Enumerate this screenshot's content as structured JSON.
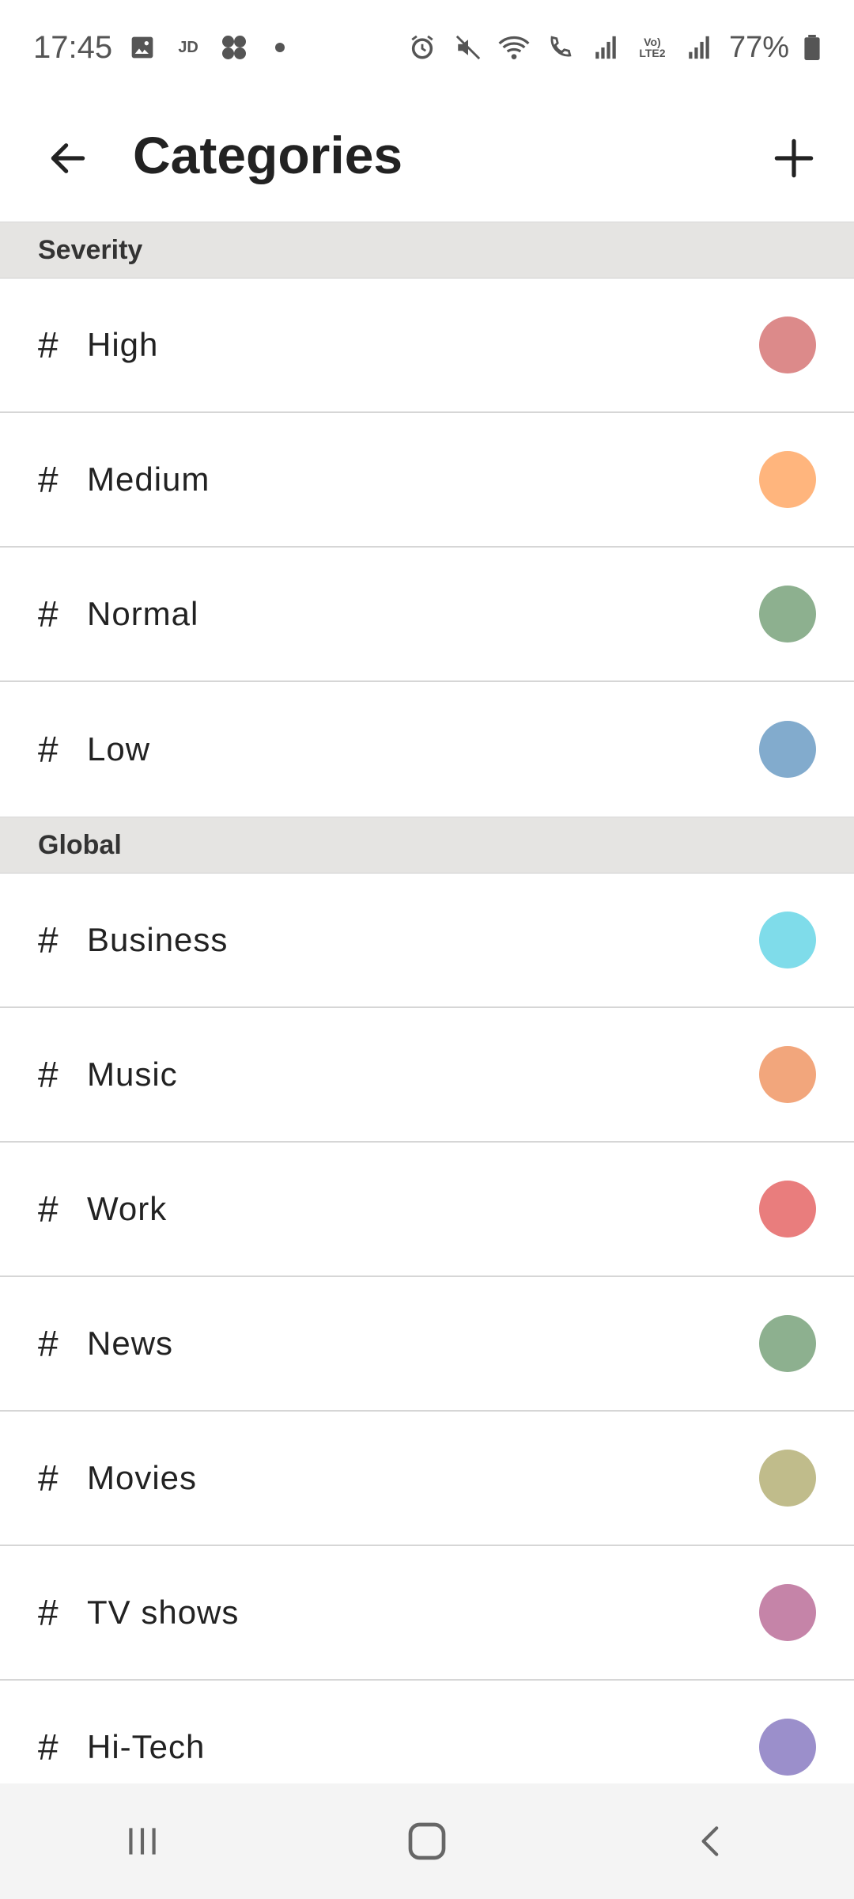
{
  "status_bar": {
    "time": "17:45",
    "left_icons": [
      "gallery-icon",
      "jd-icon",
      "fan-icon",
      "dot-icon"
    ],
    "right_icons": [
      "alarm-icon",
      "mute-icon",
      "wifi-icon",
      "call-icon",
      "signal-icon",
      "volte-icon",
      "signal-icon"
    ],
    "jd_label": "JD",
    "volte_label": "Vo) LTE2",
    "battery": "77%"
  },
  "app_bar": {
    "title": "Categories"
  },
  "sections": [
    {
      "header": "Severity",
      "items": [
        {
          "label": "High",
          "color": "#dc8a8a"
        },
        {
          "label": "Medium",
          "color": "#ffb57d"
        },
        {
          "label": "Normal",
          "color": "#8db08f"
        },
        {
          "label": "Low",
          "color": "#82abcd"
        }
      ]
    },
    {
      "header": "Global",
      "items": [
        {
          "label": "Business",
          "color": "#7fdcea"
        },
        {
          "label": "Music",
          "color": "#f2a67c"
        },
        {
          "label": "Work",
          "color": "#e97d7d"
        },
        {
          "label": "News",
          "color": "#8db08f"
        },
        {
          "label": "Movies",
          "color": "#c0bc8b"
        },
        {
          "label": "TV shows",
          "color": "#c584a8"
        },
        {
          "label": "Hi-Tech",
          "color": "#9b8fcb"
        }
      ]
    }
  ],
  "hash_symbol": "#",
  "nav_bar": {
    "buttons": [
      "recent-apps-icon",
      "home-icon",
      "back-icon"
    ]
  }
}
